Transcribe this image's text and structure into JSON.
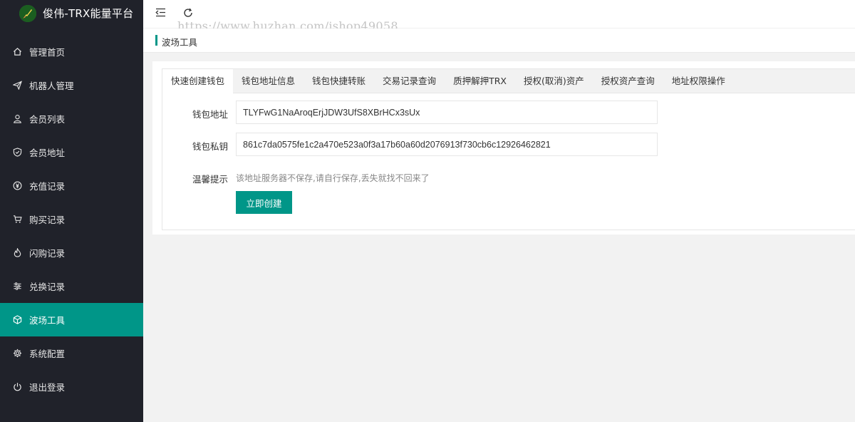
{
  "app": {
    "title": "俊伟-TRX能量平台",
    "watermark": "https://www.huzhan.com/ishop49058",
    "accent_color": "#009688",
    "sidebar_color": "#20222a"
  },
  "sidebar": {
    "items": [
      {
        "label": "管理首页",
        "icon": "home-icon"
      },
      {
        "label": "机器人管理",
        "icon": "paper-plane-icon"
      },
      {
        "label": "会员列表",
        "icon": "user-icon"
      },
      {
        "label": "会员地址",
        "icon": "shield-check-icon"
      },
      {
        "label": "充值记录",
        "icon": "yen-icon"
      },
      {
        "label": "购买记录",
        "icon": "cart-icon"
      },
      {
        "label": "闪购记录",
        "icon": "flame-icon"
      },
      {
        "label": "兑换记录",
        "icon": "sliders-icon"
      },
      {
        "label": "波场工具",
        "icon": "cube-icon",
        "active": true
      },
      {
        "label": "系统配置",
        "icon": "gear-icon"
      },
      {
        "label": "退出登录",
        "icon": "power-icon"
      }
    ]
  },
  "header": {
    "menu_toggle_icon": "indent-icon",
    "refresh_icon": "refresh-icon"
  },
  "breadcrumb": {
    "current": "波场工具"
  },
  "tabs": [
    {
      "label": "快速创建钱包",
      "active": true
    },
    {
      "label": "钱包地址信息"
    },
    {
      "label": "钱包快捷转账"
    },
    {
      "label": "交易记录查询"
    },
    {
      "label": "质押解押TRX"
    },
    {
      "label": "授权(取消)资产"
    },
    {
      "label": "授权资产查询"
    },
    {
      "label": "地址权限操作"
    }
  ],
  "form": {
    "address_label": "钱包地址",
    "address_value": "TLYFwG1NaAroqErjJDW3UfS8XBrHCx3sUx",
    "private_key_label": "钱包私钥",
    "private_key_value": "861c7da0575fe1c2a470e523a0f3a17b60a60d2076913f730cb6c12926462821",
    "tip_label": "温馨提示",
    "tip_text": "该地址服务器不保存,请自行保存,丢失就找不回来了",
    "submit_label": "立即创建"
  }
}
